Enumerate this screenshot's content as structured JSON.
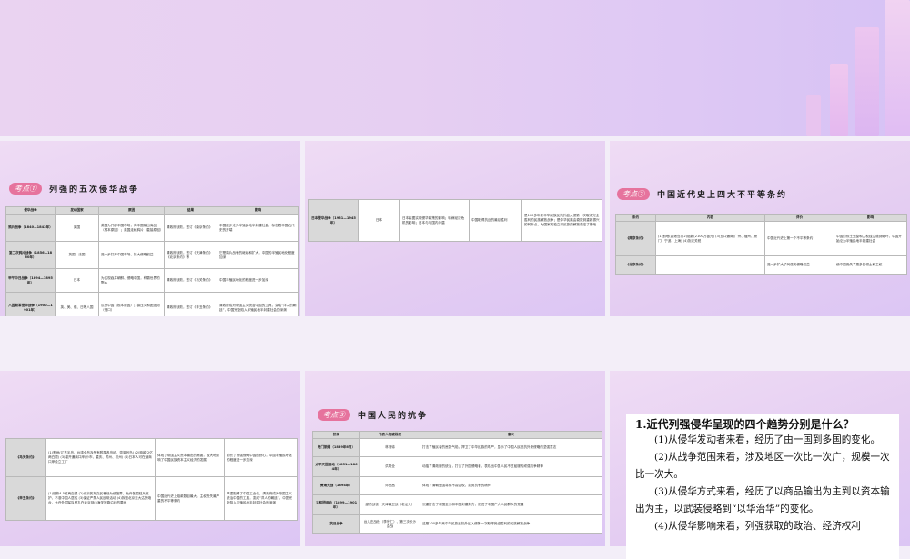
{
  "slide1": {
    "badge": "考点①",
    "title": "列强的五次侵华战争",
    "headers": [
      "侵华战争",
      "发动国家",
      "原因",
      "结果",
      "影响"
    ],
    "rows": [
      [
        "鸦片战争（1840—1842年）",
        "英国",
        "英国为开辟中国市场，向中国输出商品（根本原因）；英国走私鸦片（直接原因）",
        "清政府战败，签订《南京条约》",
        "中国逐步沦为半殖民地半封建社会，标志着中国近代史的开端"
      ],
      [
        "第二次鸦片战争（1856—1860年）",
        "英国、法国",
        "进一步打开中国市场，扩大侵略权益",
        "清政府战败，签订《天津条约》《北京条约》等",
        "它是鸦片战争的继续和扩大，中国的半殖民地化程度加深"
      ],
      [
        "甲午中日战争（1894—1895年）",
        "日本",
        "为实现吞并朝鲜、侵略中国，称霸世界的野心",
        "清政府战败，签订《马关条约》",
        "中国半殖民地化的程度进一步加深"
      ],
      [
        "八国联军侵华战争（1900—1901年）",
        "英、美、俄、日等八国",
        "瓜分中国（根本原因）；镇压义和团运动（借口）",
        "清政府战败，签订《辛丑条约》",
        "清政府成为帝国主义统治中国的工具，变成“洋人的朝廷”，中国完全陷入半殖民地半封建社会的深渊"
      ]
    ]
  },
  "slide2": {
    "row": [
      "日本侵华战争（1931—1945年）",
      "日本",
      "日本妄图实现侵华政策的影响；转嫁经济危机的影响；日本与与国内矛盾",
      "中国取得抗战的最后胜利",
      "是100多年来中华民族反抗外敌入侵第一次取得完全胜利的民族解放战争；是中华民族由衰败到重新振兴的转折点，为国家的独立和民族的解放奠定了基础"
    ]
  },
  "slide3": {
    "badge": "考点②",
    "title": "中国近代史上四大不平等条约",
    "headers": [
      "条约",
      "内容",
      "评价",
      "影响"
    ],
    "rows": [
      [
        "《南京条约》",
        "(1)割地(香港岛) (2)赔款(2100万银元) (3)五口通商(广州、福州、厦门、宁波、上海) (4)协定关税",
        "中国近代史上第一个不平等条约",
        "中国的领土完整和主权独立遭到破坏，中国开始沦为半殖民地半封建社会"
      ],
      [
        "《北京条约》",
        "——",
        "进一步扩大了列强的侵略权益",
        "使中国丧失了更多的领土和主权"
      ]
    ]
  },
  "slide4": {
    "rows": [
      [
        "《马关条约》",
        "(1)割地(辽东半岛、台湾全岛及所有附属各岛屿、澎湖列岛) (2)赔款(2亿两白银) (3)增开通商口岸(沙市、重庆、苏州、杭州) (4)日本人可在通商口岸设立工厂",
        "体现了帝国主义资本输出的需要，极大地影响了中国民族资本主义经济的发展",
        "助长了列强侵略中国的野心，中国半殖民地化的程度进一步加深"
      ],
      [
        "《辛丑条约》",
        "(1)赔款4.5亿两白银 (2)北京的东交民巷划为使馆界，允许各国驻兵保护，不准中国人居住 (3)保证严禁人民反帝活动 (4)拆毁北京至大沽的炮台，允许外国军队驻扎在北京到山海关铁路沿线的要地",
        "中国近代史上赔款数目最大，主权丧失最严重的不平等条约",
        "严重阻碍了中国工业化，清政府成为帝国主义统治中国的工具，变成“洋人的朝廷”，中国完全陷入半殖民地半封建社会的深渊"
      ]
    ]
  },
  "slide5": {
    "badge": "考点③",
    "title": "中国人民的抗争",
    "headers": [
      "抗争",
      "代表人物或政权",
      "意义"
    ],
    "rows": [
      [
        "虎门销烟（1839年6月）",
        "林则徐",
        "打击了殖民者的嚣张气焰，捍卫了中华民族的尊严，显示了中国人民抵抗外来侵略的坚强意志"
      ],
      [
        "太平天国运动（1851—1864年）",
        "洪秀全",
        "动摇了清政府的统治，打击了外国侵略者，表现出中国人民不甘屈服的顽强抗争精神"
      ],
      [
        "黄海大战（1894年）",
        "邓世昌",
        "体现了清朝爱国将领不畏强权，英勇抗争的精神"
      ],
      [
        "义和团运动（1899—1901年）",
        "廊坊战役、天津保卫战（老龙头）",
        "沉重打击了帝国主义和中国封建势力，促进了中国广大人民群众的觉醒"
      ],
      [
        "抗日战争",
        "台儿庄战役（李宗仁）、第三次长沙会战",
        "这是100多年来中华民族反抗外敌入侵第一次取得完全胜利的民族解放战争"
      ]
    ]
  },
  "qa": {
    "question": "1.近代列强侵华呈现的四个趋势分别是什么？",
    "answers": [
      "(1)从侵华发动者来看，经历了由一国到多国的变化。",
      "(2)从战争范围来看，涉及地区一次比一次广，规模一次比一次大。",
      "(3)从侵华方式来看，经历了以商品输出为主到以资本输出为主，以武装侵略到“以华治华”的变化。",
      "(4)从侵华影响来看，列强获取的政治、经济权利"
    ]
  },
  "colors": {
    "badge": "#e6739d",
    "header_bg": "#d9d9d9",
    "slide_bg": "#e4cdf2"
  }
}
